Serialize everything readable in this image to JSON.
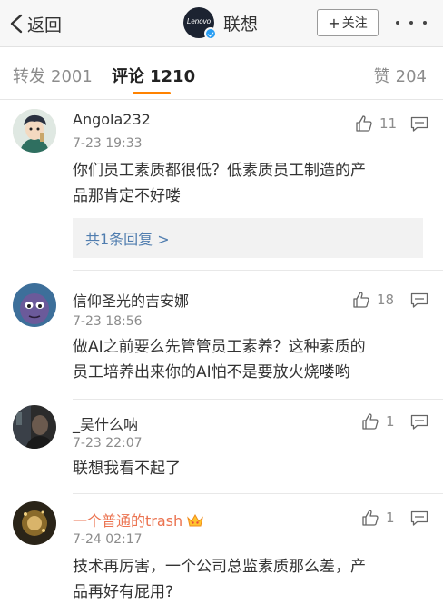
{
  "nav": {
    "back_label": "返回",
    "account_name": "联想",
    "avatar_text": "Lenovo",
    "follow_plus": "+",
    "follow_label": "关注"
  },
  "tabs": {
    "repost": {
      "label": "转发",
      "count": "2001"
    },
    "comments": {
      "label": "评论",
      "count": "1210"
    },
    "likes": {
      "label": "赞",
      "count": "204"
    }
  },
  "colors": {
    "accent": "#ff8200",
    "link": "#507daf",
    "vip_name": "#eb7350",
    "muted": "#8c8c8c"
  },
  "comments": [
    {
      "user": "Angola232",
      "time": "7-23 19:33",
      "likes": "11",
      "text_lines": [
        "你们员工素质都很低？低素质员工制造的产",
        "品那肯定不好喽"
      ],
      "replies_label": "共1条回复 >"
    },
    {
      "user": "信仰圣光的吉安娜",
      "time": "7-23 18:56",
      "likes": "18",
      "text_lines": [
        "做AI之前要么先管管员工素养？这种素质的",
        "员工培养出来你的AI怕不是要放火烧喽哟"
      ]
    },
    {
      "user": "_吴什么呐",
      "time": "7-23 22:07",
      "likes": "1",
      "text_lines": [
        "联想我看不起了"
      ]
    },
    {
      "user": "一个普通的trash",
      "time": "7-24 02:17",
      "likes": "1",
      "text_lines": [
        "技术再厉害，一个公司总监素质那么差，产",
        "品再好有屁用?"
      ]
    }
  ],
  "icons": {
    "back": "chevron-left-icon",
    "more": "more-dots-icon",
    "like": "thumbs-up-icon",
    "reply": "comment-bubble-icon",
    "vip": "crown-icon"
  }
}
